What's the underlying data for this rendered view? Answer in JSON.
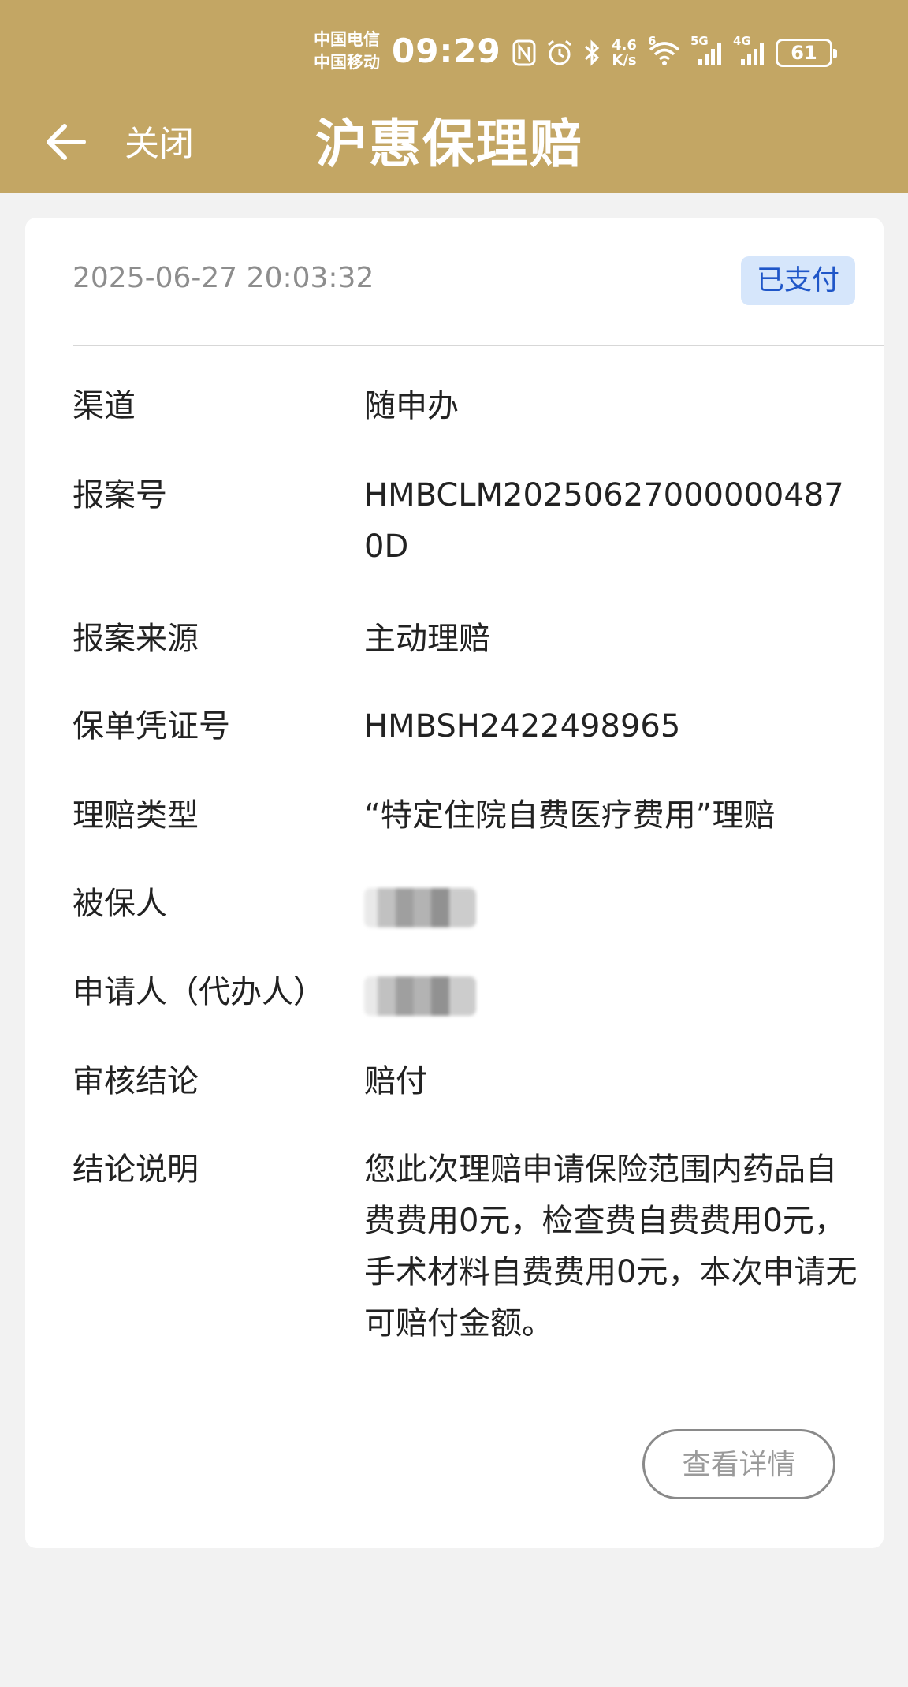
{
  "status_bar": {
    "carrier_1": "中国电信",
    "carrier_2": "中国移动",
    "time": "09:29",
    "net_speed_value": "4.6",
    "net_speed_unit": "K/s",
    "wifi_tag": "6",
    "signal_1_tag": "5G",
    "signal_2_tag": "4G",
    "battery_level": "61",
    "icons": [
      "nfc-icon",
      "alarm-icon",
      "bluetooth-icon",
      "wifi-icon",
      "signal-icon",
      "battery-icon"
    ]
  },
  "header": {
    "close_label": "关闭",
    "title": "沪惠保理赔",
    "background_color": "#c3a664"
  },
  "claim": {
    "datetime": "2025-06-27 20:03:32",
    "status": "已支付",
    "rows": [
      {
        "label": "渠道",
        "value": "随申办"
      },
      {
        "label": "报案号",
        "value": "HMBCLM20250627000000487 0D"
      },
      {
        "label": "报案来源",
        "value": "主动理赔"
      },
      {
        "label": "保单凭证号",
        "value": "HMBSH2422498965"
      },
      {
        "label": "理赔类型",
        "value": "“特定住院自费医疗费用”理赔"
      },
      {
        "label": "被保人",
        "value": ""
      },
      {
        "label": "申请人（代办人）",
        "value": ""
      },
      {
        "label": "审核结论",
        "value": "赔付"
      },
      {
        "label": "结论说明",
        "value": "您此次理赔申请保险范围内药品自费费用0元，检查费自费费用0元，手术材料自费费用0元，本次申请无可赔付金额。"
      }
    ],
    "detail_button_label": "查看详情"
  }
}
